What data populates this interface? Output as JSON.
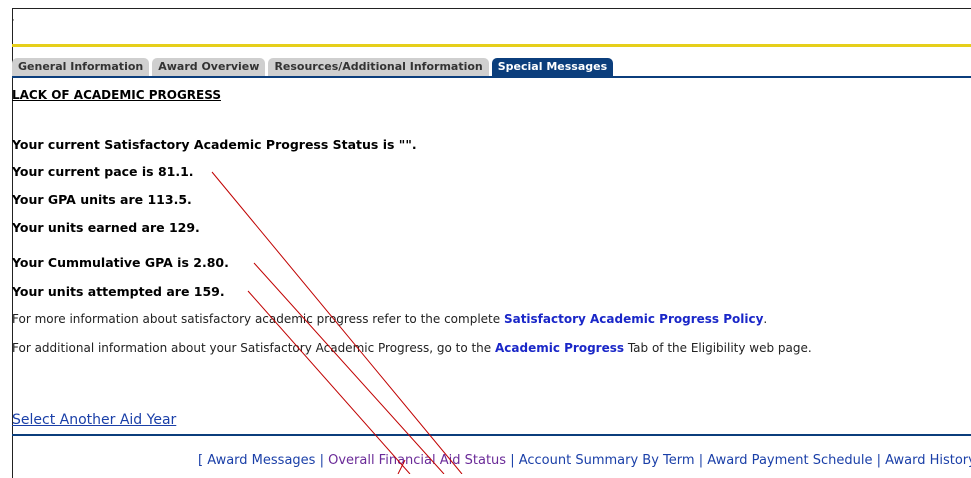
{
  "tabs": [
    {
      "label": "General Information"
    },
    {
      "label": "Award Overview"
    },
    {
      "label": "Resources/Additional Information"
    },
    {
      "label": "Special Messages",
      "active": true
    }
  ],
  "section": {
    "title": "LACK OF ACADEMIC PROGRESS"
  },
  "status_lines": [
    "Your current Satisfactory Academic Progress Status is \"\".",
    "Your current pace is 81.1.",
    "Your GPA units are 113.5.",
    "Your units earned are 129.",
    "Your Cummulative GPA is 2.80.",
    "Your units attempted are 159."
  ],
  "info1": {
    "prefix": "For more information about satisfactory academic progress refer to the complete ",
    "link": "Satisfactory Academic Progress Policy",
    "suffix": "."
  },
  "info2": {
    "prefix": "For additional information about your Satisfactory Academic Progress, go to the ",
    "link": "Academic Progress",
    "suffix": " Tab of the Eligibility web page."
  },
  "select_aid_year": "Select Another Aid Year",
  "footer": {
    "open": "[ ",
    "close": " ]",
    "sep": " | ",
    "links": [
      "Award Messages",
      "Overall Financial Aid Status",
      "Account Summary By Term",
      "Award Payment Schedule",
      "Award History"
    ]
  },
  "corner_mark": "·",
  "colors": {
    "accent_navy": "#0b3e7c",
    "gold": "#e6cf1a",
    "link_blue": "#1a27c8",
    "annotation_red": "#c00000"
  }
}
